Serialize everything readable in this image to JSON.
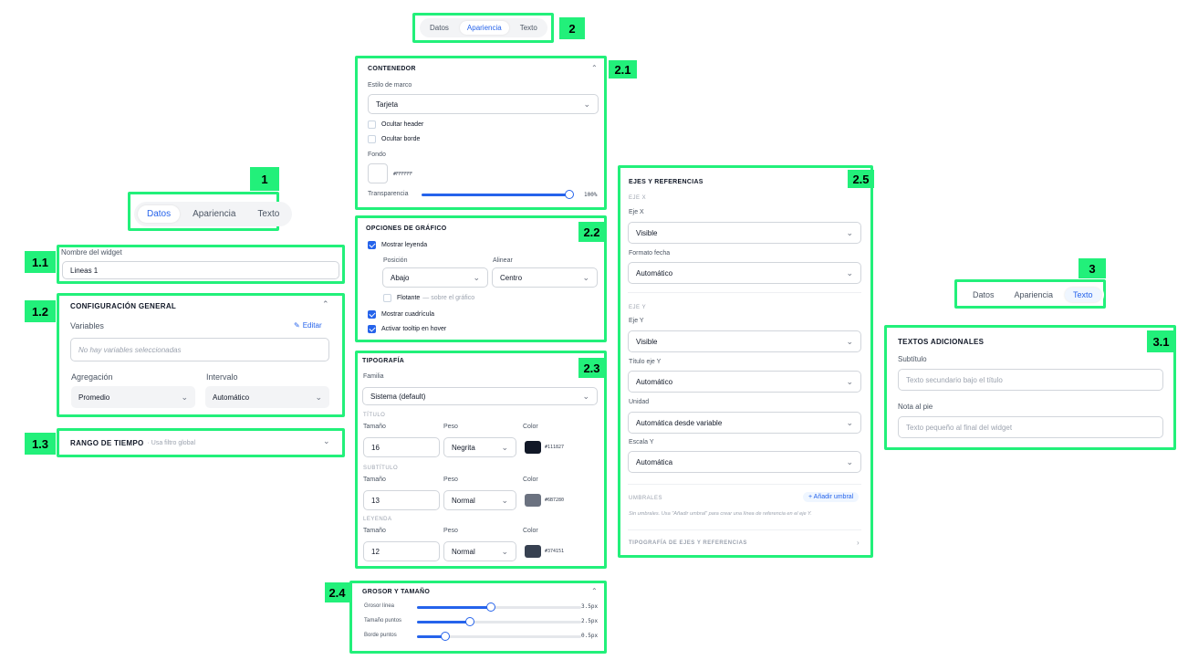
{
  "tabs": {
    "datos": "Datos",
    "apariencia": "Apariencia",
    "texto": "Texto"
  },
  "tags": {
    "t1": "1",
    "t11": "1.1",
    "t12": "1.2",
    "t13": "1.3",
    "t2": "2",
    "t21": "2.1",
    "t22": "2.2",
    "t23": "2.3",
    "t24": "2.4",
    "t25": "2.5",
    "t3": "3",
    "t31": "3.1"
  },
  "p11": {
    "label": "Nombre del widget",
    "value": "Lineas 1"
  },
  "p12": {
    "title": "CONFIGURACIÓN GENERAL",
    "variables": "Variables",
    "edit": "Editar",
    "empty": "No hay variables seleccionadas",
    "agg_label": "Agregación",
    "agg_value": "Promedio",
    "int_label": "Intervalo",
    "int_value": "Automático"
  },
  "p13": {
    "title": "RANGO DE TIEMPO",
    "hint": "· Usa filtro global"
  },
  "p21": {
    "title": "CONTENEDOR",
    "frame_label": "Estilo de marco",
    "frame_value": "Tarjeta",
    "hide_header": "Ocultar header",
    "hide_border": "Ocultar borde",
    "bg_label": "Fondo",
    "bg_hex": "#FFFFFF",
    "transp_label": "Transparencia",
    "transp_value": "100%",
    "transp_level": 1.0
  },
  "p22": {
    "title": "OPCIONES DE GRÁFICO",
    "show_legend": "Mostrar leyenda",
    "pos_label": "Posición",
    "pos_value": "Abajo",
    "align_label": "Alinear",
    "align_value": "Centro",
    "floating": "Flotante",
    "floating_hint": "— sobre el gráfico",
    "show_grid": "Mostrar cuadrícula",
    "tooltip": "Activar tooltip en hover"
  },
  "p23": {
    "title": "TIPOGRAFÍA",
    "family_label": "Familia",
    "family_value": "Sistema (default)",
    "groups": [
      {
        "name": "TÍTULO",
        "size_label": "Tamaño",
        "weight_label": "Peso",
        "color_label": "Color",
        "size": "16",
        "weight": "Negrita",
        "color": "#111827"
      },
      {
        "name": "SUBTÍTULO",
        "size_label": "Tamaño",
        "weight_label": "Peso",
        "color_label": "Color",
        "size": "13",
        "weight": "Normal",
        "color": "#6B7280"
      },
      {
        "name": "LEYENDA",
        "size_label": "Tamaño",
        "weight_label": "Peso",
        "color_label": "Color",
        "size": "12",
        "weight": "Normal",
        "color": "#374151"
      }
    ]
  },
  "p24": {
    "title": "GROSOR Y TAMAÑO",
    "sliders": [
      {
        "label": "Grosor línea",
        "value": "3.5px",
        "level": 0.45
      },
      {
        "label": "Tamaño puntos",
        "value": "2.5px",
        "level": 0.32
      },
      {
        "label": "Borde puntos",
        "value": "0.5px",
        "level": 0.17
      }
    ]
  },
  "p25": {
    "title": "EJES Y REFERENCIAS",
    "ejex_sub": "EJE X",
    "ejex_label": "Eje X",
    "ejex_value": "Visible",
    "fmt_label": "Formato fecha",
    "fmt_value": "Automático",
    "ejey_sub": "EJE Y",
    "ejey_label": "Eje Y",
    "ejey_value": "Visible",
    "tity_label": "Título eje Y",
    "tity_value": "Automático",
    "unit_label": "Unidad",
    "unit_value": "Automática desde variable",
    "scale_label": "Escala Y",
    "scale_value": "Automática",
    "thr_title": "UMBRALES",
    "thr_add": "+ Añadir umbral",
    "thr_empty": "Sin umbrales. Usa \"Añadir umbral\" para crear una línea de referencia en el eje Y.",
    "typo_title": "TIPOGRAFÍA DE EJES Y REFERENCIAS"
  },
  "p31": {
    "title": "TEXTOS ADICIONALES",
    "sub_label": "Subtítulo",
    "sub_ph": "Texto secundario bajo el título",
    "note_label": "Nota al pie",
    "note_ph": "Texto pequeño al final del widget"
  }
}
